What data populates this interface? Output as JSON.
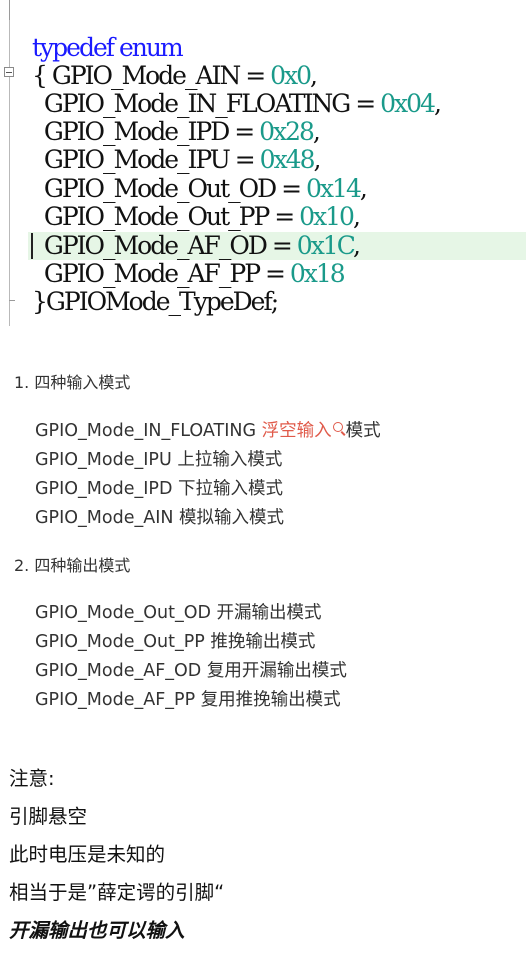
{
  "code": {
    "lines": [
      {
        "parts": [
          {
            "t": "typedef enum",
            "c": "kw"
          }
        ]
      },
      {
        "parts": [
          {
            "t": "{ GPIO_Mode_AIN = ",
            "c": ""
          },
          {
            "t": "0x0",
            "c": "num"
          },
          {
            "t": ",",
            "c": ""
          }
        ]
      },
      {
        "parts": [
          {
            "t": "  GPIO_Mode_IN_FLOATING = ",
            "c": ""
          },
          {
            "t": "0x04",
            "c": "num"
          },
          {
            "t": ",",
            "c": ""
          }
        ]
      },
      {
        "parts": [
          {
            "t": "  GPIO_Mode_IPD = ",
            "c": ""
          },
          {
            "t": "0x28",
            "c": "num"
          },
          {
            "t": ",",
            "c": ""
          }
        ]
      },
      {
        "parts": [
          {
            "t": "  GPIO_Mode_IPU = ",
            "c": ""
          },
          {
            "t": "0x48",
            "c": "num"
          },
          {
            "t": ",",
            "c": ""
          }
        ]
      },
      {
        "parts": [
          {
            "t": "  GPIO_Mode_Out_OD = ",
            "c": ""
          },
          {
            "t": "0x14",
            "c": "num"
          },
          {
            "t": ",",
            "c": ""
          }
        ]
      },
      {
        "parts": [
          {
            "t": "  GPIO_Mode_Out_PP = ",
            "c": ""
          },
          {
            "t": "0x10",
            "c": "num"
          },
          {
            "t": ",",
            "c": ""
          }
        ]
      },
      {
        "parts": [
          {
            "t": "  GPIO_Mode_AF_OD = ",
            "c": ""
          },
          {
            "t": "0x1C",
            "c": "num"
          },
          {
            "t": ",",
            "c": ""
          }
        ]
      },
      {
        "parts": [
          {
            "t": "  GPIO_Mode_AF_PP = ",
            "c": ""
          },
          {
            "t": "0x18",
            "c": "num"
          }
        ]
      },
      {
        "parts": [
          {
            "t": "}GPIOMode_TypeDef;",
            "c": ""
          }
        ]
      }
    ]
  },
  "section1": {
    "heading": "1. 四种输入模式",
    "items": [
      {
        "name": "GPIO_Mode_IN_FLOATING ",
        "link": "浮空输入",
        "desc": "模式"
      },
      {
        "name": "GPIO_Mode_IPU ",
        "desc": "上拉输入模式"
      },
      {
        "name": "GPIO_Mode_IPD ",
        "desc": "下拉输入模式"
      },
      {
        "name": "GPIO_Mode_AIN ",
        "desc": "模拟输入模式"
      }
    ]
  },
  "section2": {
    "heading": "2. 四种输出模式",
    "items": [
      {
        "name": "GPIO_Mode_Out_OD ",
        "desc": "开漏输出模式"
      },
      {
        "name": "GPIO_Mode_Out_PP ",
        "desc": "推挽输出模式"
      },
      {
        "name": "GPIO_Mode_AF_OD ",
        "desc": "复用开漏输出模式"
      },
      {
        "name": "GPIO_Mode_AF_PP ",
        "desc": "复用推挽输出模式"
      }
    ]
  },
  "notes": {
    "line1": "注意:",
    "line2": "引脚悬空",
    "line3": "此时电压是未知的",
    "line4": "相当于是”薛定谔的引脚“",
    "line5": "开漏输出也可以输入"
  },
  "colors": {
    "keyword": "#1a1aff",
    "number": "#1a9a8a",
    "link": "#e05a4a",
    "highlight": "#e6f6e6"
  },
  "icons": {
    "search": "search-icon",
    "fold": "collapse-icon"
  }
}
